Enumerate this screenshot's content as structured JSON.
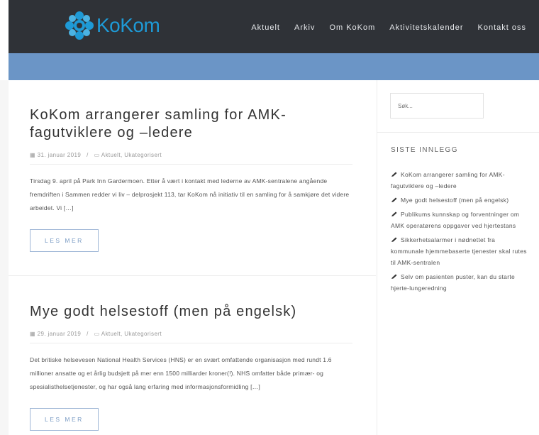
{
  "header": {
    "logo_text": "KoKom",
    "nav": [
      "Aktuelt",
      "Arkiv",
      "Om KoKom",
      "Aktivitetskalender",
      "Kontakt oss"
    ]
  },
  "posts": [
    {
      "title": "KoKom arrangerer samling for AMK-fagutviklere og –ledere",
      "date": "31. januar 2019",
      "categories": "Aktuelt, Ukategorisert",
      "excerpt": "Tirsdag 9. april på Park Inn Gardermoen. Etter å vært i kontakt med lederne av AMK-sentralene angående fremdriften i Sammen redder vi liv – delprosjekt 113, tar KoKom nå initiativ til en samling for å samkjøre det videre arbeidet. Vi […]",
      "button": "LES MER"
    },
    {
      "title": "Mye godt helsestoff (men på engelsk)",
      "date": "29. januar 2019",
      "categories": "Aktuelt, Ukategorisert",
      "excerpt": "Det britiske helsevesen National Health Services (HNS) er en svært omfattende organisasjon med rundt 1.6 millioner ansatte og et årlig budsjett på mer enn 1500 milliarder kroner(!). NHS omfatter både primær- og spesialisthelsetjenester, og har også lang erfaring med informasjonsformidling […]",
      "button": "LES MER"
    }
  ],
  "sidebar": {
    "search_placeholder": "Søk...",
    "recent_title": "SISTE INNLEGG",
    "recent": [
      "KoKom arrangerer samling for AMK-fagutviklere og –ledere",
      "Mye godt helsestoff (men på engelsk)",
      "Publikums kunnskap og forventninger om AMK operatørens oppgaver ved hjertestans",
      "Sikkerhetsalarmer i nødnettet fra kommunale hjemmebaserte tjenester skal rutes til AMK-sentralen",
      "Selv om pasienten puster, kan du starte hjerte-lungeredning"
    ]
  },
  "colors": {
    "topbar": "#2f3237",
    "band": "#6b95c6",
    "logo": "#1e9ad6",
    "button": "#7b9cc4"
  }
}
